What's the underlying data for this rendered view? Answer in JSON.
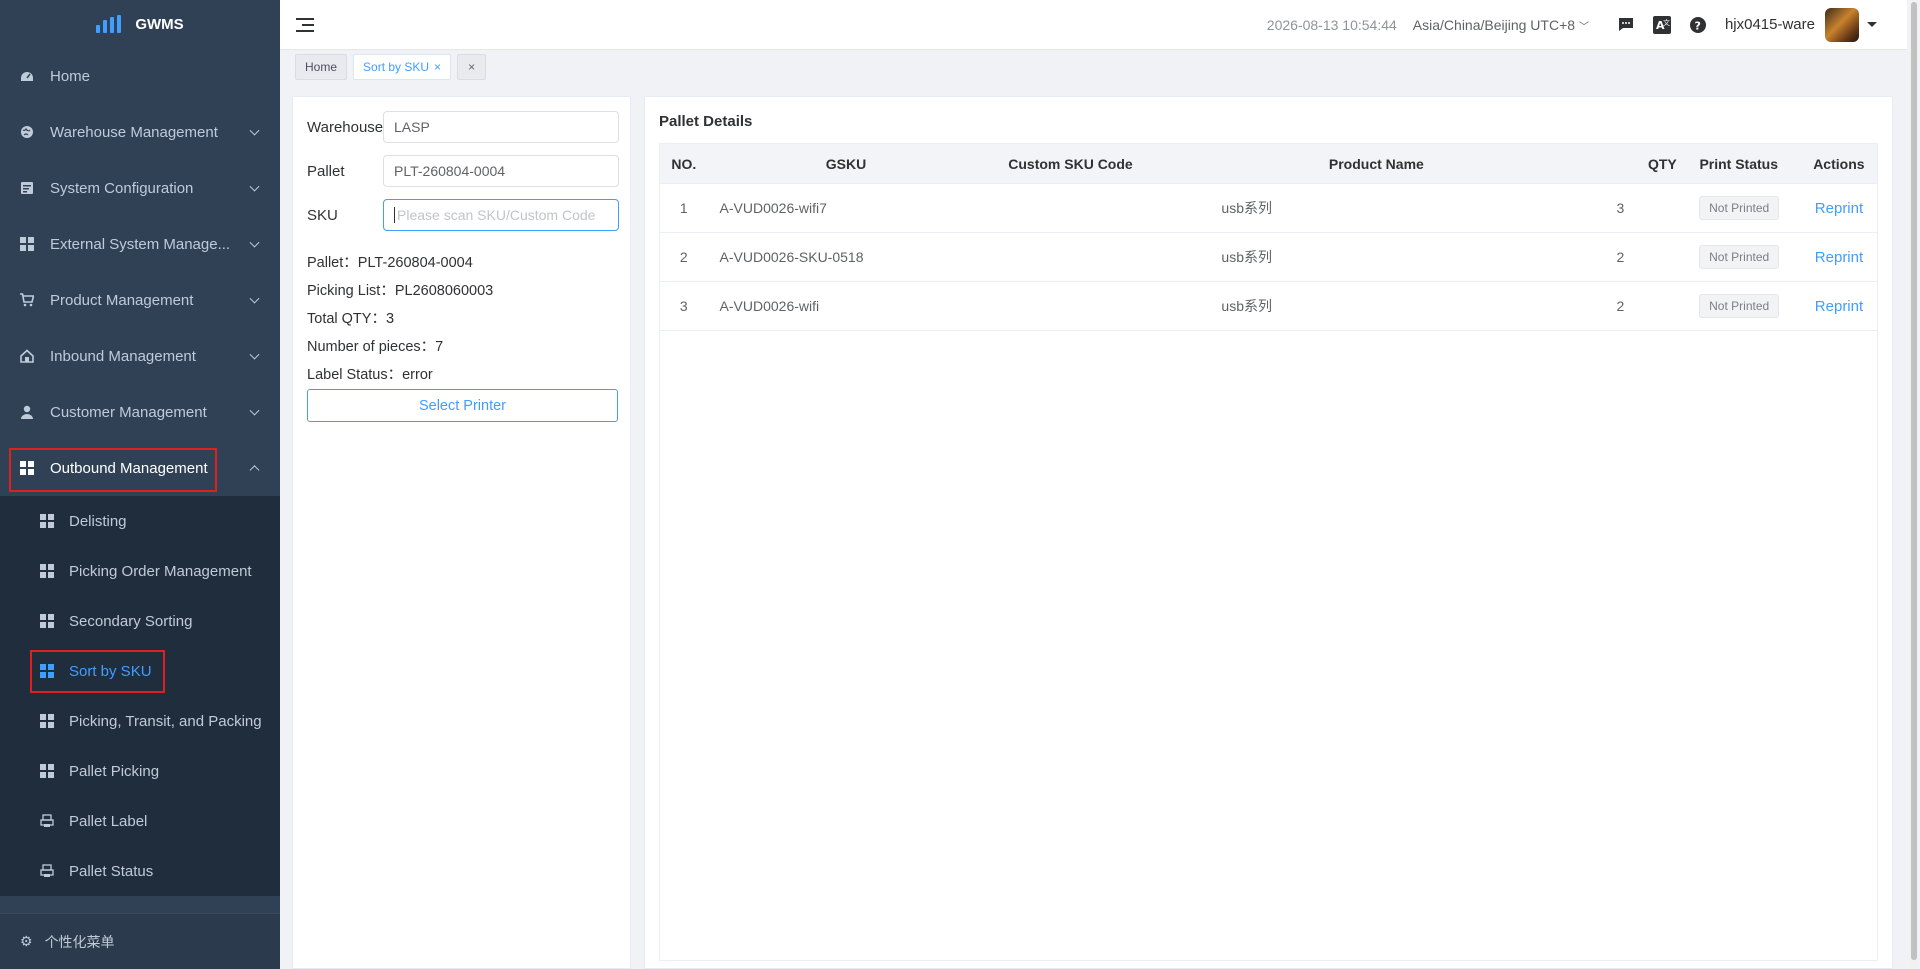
{
  "app": {
    "name": "GWMS"
  },
  "sidebar": {
    "items": [
      {
        "label": "Home"
      },
      {
        "label": "Warehouse Management"
      },
      {
        "label": "System Configuration"
      },
      {
        "label": "External System Manage..."
      },
      {
        "label": "Product Management"
      },
      {
        "label": "Inbound Management"
      },
      {
        "label": "Customer Management"
      },
      {
        "label": "Outbound Management"
      }
    ],
    "submenu": [
      {
        "label": "Delisting"
      },
      {
        "label": "Picking Order Management"
      },
      {
        "label": "Secondary Sorting"
      },
      {
        "label": "Sort by SKU"
      },
      {
        "label": "Picking, Transit, and Packing"
      },
      {
        "label": "Pallet Picking"
      },
      {
        "label": "Pallet Label"
      },
      {
        "label": "Pallet Status"
      }
    ],
    "footer": "个性化菜单"
  },
  "header": {
    "datetime": "2026-08-13 10:54:44",
    "timezone": "Asia/China/Beijing UTC+8",
    "username": "hjx0415-ware"
  },
  "tags": {
    "home": "Home",
    "active": "Sort by SKU",
    "close_all": "×"
  },
  "form": {
    "warehouse_label": "Warehouse",
    "warehouse_value": "LASP",
    "pallet_label": "Pallet",
    "pallet_value": "PLT-260804-0004",
    "sku_label": "SKU",
    "sku_placeholder": "Please scan SKU/Custom Code"
  },
  "summary": {
    "pallet": "Pallet：PLT-260804-0004",
    "picking_list": "Picking List：PL2608060003",
    "total_qty": "Total QTY：3",
    "pieces": "Number of pieces：7",
    "label_status": "Label Status：error"
  },
  "select_printer": "Select Printer",
  "pallet_details": {
    "title": "Pallet Details",
    "columns": [
      "NO.",
      "GSKU",
      "Custom SKU Code",
      "Product Name",
      "QTY",
      "Print Status",
      "Actions"
    ],
    "rows": [
      {
        "no": "1",
        "gsku": "A-VUD0026-wifi7",
        "custom_sku": "",
        "product_name": "usb系列",
        "qty": "3",
        "print_status": "Not Printed",
        "action": "Reprint"
      },
      {
        "no": "2",
        "gsku": "A-VUD0026-SKU-0518",
        "custom_sku": "",
        "product_name": "usb系列",
        "qty": "2",
        "print_status": "Not Printed",
        "action": "Reprint"
      },
      {
        "no": "3",
        "gsku": "A-VUD0026-wifi",
        "custom_sku": "",
        "product_name": "usb系列",
        "qty": "2",
        "print_status": "Not Printed",
        "action": "Reprint"
      }
    ]
  }
}
